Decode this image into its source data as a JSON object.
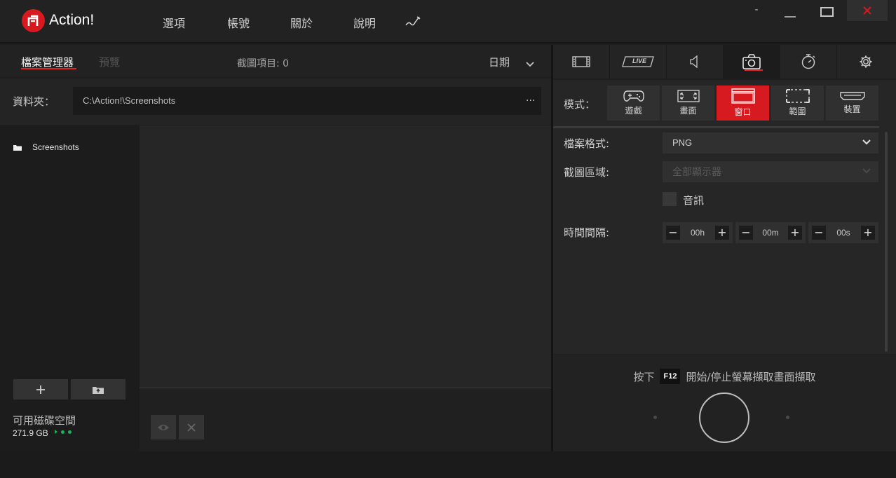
{
  "app": {
    "title": "Action!"
  },
  "menu": [
    "選項",
    "帳號",
    "關於",
    "說明"
  ],
  "window_controls": {
    "minimize": "-"
  },
  "file_manager": {
    "tabs": [
      "檔案管理器",
      "預覽"
    ],
    "capture_count_label": "截圖項目: 0",
    "sort_label": "日期",
    "folder_label": "資料夾：",
    "folder_path": "C:\\Action!\\Screenshots",
    "browse_label": "...",
    "tree": [
      {
        "label": "Screenshots"
      }
    ],
    "disk_space_label": "可用磁碟空間",
    "disk_space_value": "271.9 GB"
  },
  "right_panel": {
    "tabs": [
      "video-icon",
      "live-icon",
      "audio-icon",
      "camera-icon",
      "timer-icon",
      "gear-icon"
    ],
    "active_tab": "camera-icon",
    "live_badge": "LIVE",
    "mode_label": "模式：",
    "modes": [
      {
        "label": "遊戲",
        "icon": "gamepad-icon",
        "active": false
      },
      {
        "label": "畫面",
        "icon": "fullscreen-icon",
        "active": false
      },
      {
        "label": "窗口",
        "icon": "window-icon",
        "active": true
      },
      {
        "label": "範圍",
        "icon": "region-icon",
        "active": false
      },
      {
        "label": "裝置",
        "icon": "hdmi-icon",
        "active": false
      }
    ],
    "file_format_label": "檔案格式:",
    "file_format_value": "PNG",
    "capture_area_label": "截圖區域:",
    "capture_area_value": "全部顯示器",
    "audio_label": "音訊",
    "audio_checked": false,
    "interval_label": "時間間隔:",
    "interval": {
      "hours": "00h",
      "minutes": "00m",
      "seconds": "00s"
    },
    "hotkey_prefix": "按下",
    "hotkey_key": "F12",
    "hotkey_suffix": "開始/停止螢幕擷取畫面擷取"
  },
  "colors": {
    "accent": "#d71920",
    "disk_ok": "#19b35a"
  }
}
